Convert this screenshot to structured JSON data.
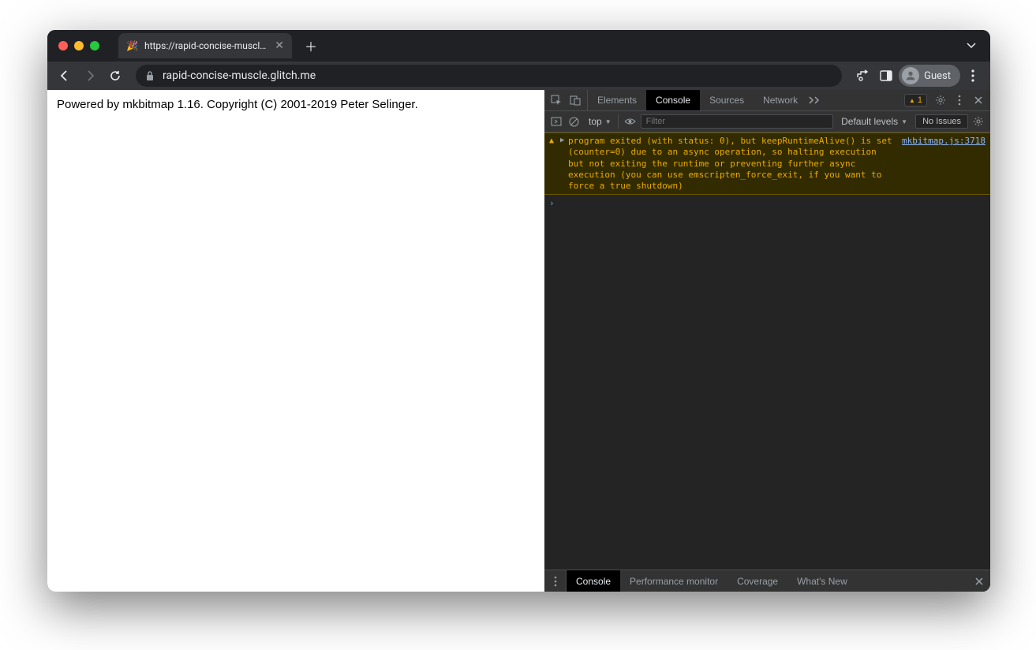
{
  "tab": {
    "title": "https://rapid-concise-muscle.g",
    "favicon": "🎉"
  },
  "toolbar": {
    "url": "rapid-concise-muscle.glitch.me",
    "guest_label": "Guest"
  },
  "page": {
    "body_text": "Powered by mkbitmap 1.16. Copyright (C) 2001-2019 Peter Selinger."
  },
  "devtools": {
    "tabs": {
      "elements": "Elements",
      "console": "Console",
      "sources": "Sources",
      "network": "Network"
    },
    "warning_count": "1",
    "console_toolbar": {
      "context": "top",
      "filter_placeholder": "Filter",
      "levels": "Default levels",
      "issues": "No Issues"
    },
    "console_message": {
      "text": "program exited (with status: 0), but keepRuntimeAlive() is set (counter=0) due to an async operation, so halting execution but not exiting the runtime or preventing further async execution (you can use emscripten_force_exit, if you want to force a true shutdown)",
      "source": "mkbitmap.js:3718"
    },
    "drawer": {
      "console": "Console",
      "perf": "Performance monitor",
      "coverage": "Coverage",
      "whatsnew": "What's New"
    }
  }
}
